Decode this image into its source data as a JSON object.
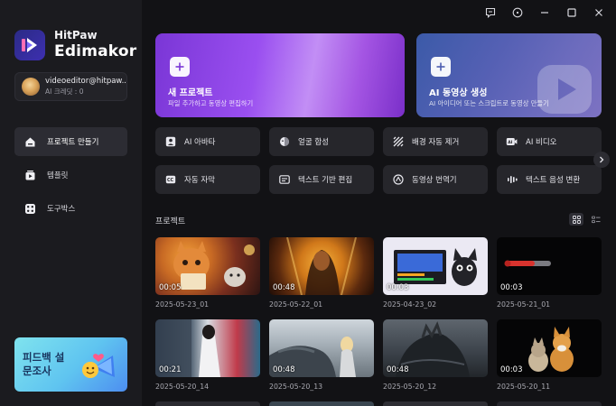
{
  "app": {
    "brand_line1": "HitPaw",
    "brand_line2": "Edimakor"
  },
  "account": {
    "email": "videoeditor@hitpaw...",
    "credits": "AI 크레딧 : 0"
  },
  "sidebar": {
    "items": [
      {
        "label": "프로젝트 만들기",
        "icon": "home-icon",
        "active": true
      },
      {
        "label": "템플릿",
        "icon": "template-icon",
        "active": false
      },
      {
        "label": "도구박스",
        "icon": "toolbox-icon",
        "active": false
      }
    ],
    "banner": {
      "text": "피드백 설문조사"
    }
  },
  "window": {
    "controls": [
      "feedback-icon",
      "help-icon",
      "minimize-icon",
      "maximize-icon",
      "close-icon"
    ]
  },
  "hero": {
    "new_project": {
      "title": "새 프로젝트",
      "subtitle": "파일 추가하고 동영상 편집하기"
    },
    "ai_video": {
      "title": "AI 동영상 생성",
      "subtitle": "AI 아이디어 또는 스크립트로 동영상 만들기"
    }
  },
  "tools": [
    {
      "label": "AI 아바타",
      "icon": "avatar-icon"
    },
    {
      "label": "얼굴 합성",
      "icon": "face-swap-icon"
    },
    {
      "label": "배경 자동 제거",
      "icon": "background-remove-icon"
    },
    {
      "label": "AI 비디오",
      "icon": "ai-video-icon"
    },
    {
      "label": "자동 자막",
      "icon": "subtitle-icon"
    },
    {
      "label": "텍스트 기반 편집",
      "icon": "text-edit-icon"
    },
    {
      "label": "동영상 번역기",
      "icon": "translate-icon"
    },
    {
      "label": "텍스트 음성 변환",
      "icon": "text-to-speech-icon"
    }
  ],
  "projects": {
    "title": "프로젝트",
    "items": [
      {
        "name": "2025-05-23_01",
        "duration": "00:05"
      },
      {
        "name": "2025-05-22_01",
        "duration": "00:48"
      },
      {
        "name": "2025-04-23_02",
        "duration": "00:03"
      },
      {
        "name": "2025-05-21_01",
        "duration": "00:03"
      },
      {
        "name": "2025-05-20_14",
        "duration": "00:21"
      },
      {
        "name": "2025-05-20_13",
        "duration": "00:48"
      },
      {
        "name": "2025-05-20_12",
        "duration": "00:48"
      },
      {
        "name": "2025-05-20_11",
        "duration": "00:03"
      }
    ]
  }
}
